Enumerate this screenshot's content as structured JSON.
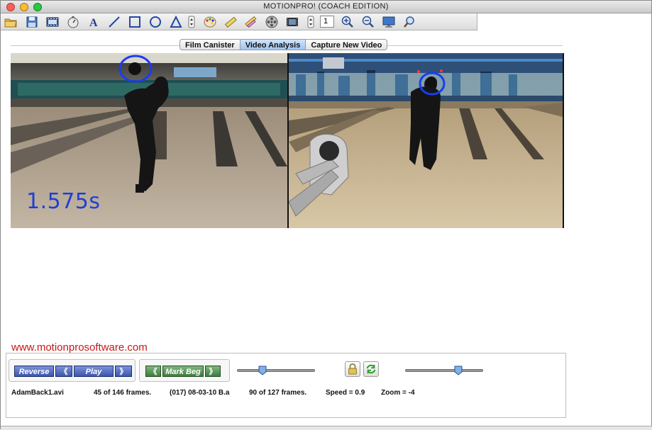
{
  "window": {
    "title": "MOTIONPRO! (COACH EDITION)",
    "traffic_lights": {
      "close": "#ff5f57",
      "minimize": "#febc2e",
      "zoom": "#28c840"
    }
  },
  "toolbar": {
    "icons": [
      "folder-open-icon",
      "save-icon",
      "film-strip-icon",
      "stopwatch-icon",
      "text-tool-icon",
      "line-tool-icon",
      "rectangle-tool-icon",
      "circle-tool-icon",
      "triangle-tool-icon",
      "stepper-icon",
      "color-palette-icon",
      "ruler-icon",
      "ruler-multi-icon",
      "film-reel-icon",
      "film-frame-icon",
      "stepper-icon",
      "zoom-in-icon",
      "zoom-out-icon",
      "monitor-icon",
      "magnifier-icon"
    ],
    "frame_step_value": "1"
  },
  "tabs": [
    {
      "label": "Film Canister",
      "active": false
    },
    {
      "label": "Video Analysis",
      "active": true
    },
    {
      "label": "Capture New Video",
      "active": false
    }
  ],
  "video": {
    "timer": "1.575s",
    "marker_color": "#1a3cf0"
  },
  "website": "www.motionprosoftware.com",
  "transport": {
    "reverse_label": "Reverse",
    "rewind_label": "《",
    "play_label": "Play",
    "forward_label": "》"
  },
  "mark": {
    "prev_label": "《",
    "mark_beg_label": "Mark Beg",
    "next_label": "》"
  },
  "sliders": {
    "left_position": 0.33,
    "right_position": 0.68
  },
  "buttons": {
    "lock_icon": "lock-icon",
    "sync_icon": "sync-icon"
  },
  "status": {
    "file1": "AdamBack1.avi",
    "frames1": "45 of 146 frames.",
    "file2": "(017) 08-03-10 B.a",
    "frames2": "90 of 127 frames.",
    "speed": "Speed = 0.9",
    "zoom": "Zoom =  -4"
  }
}
